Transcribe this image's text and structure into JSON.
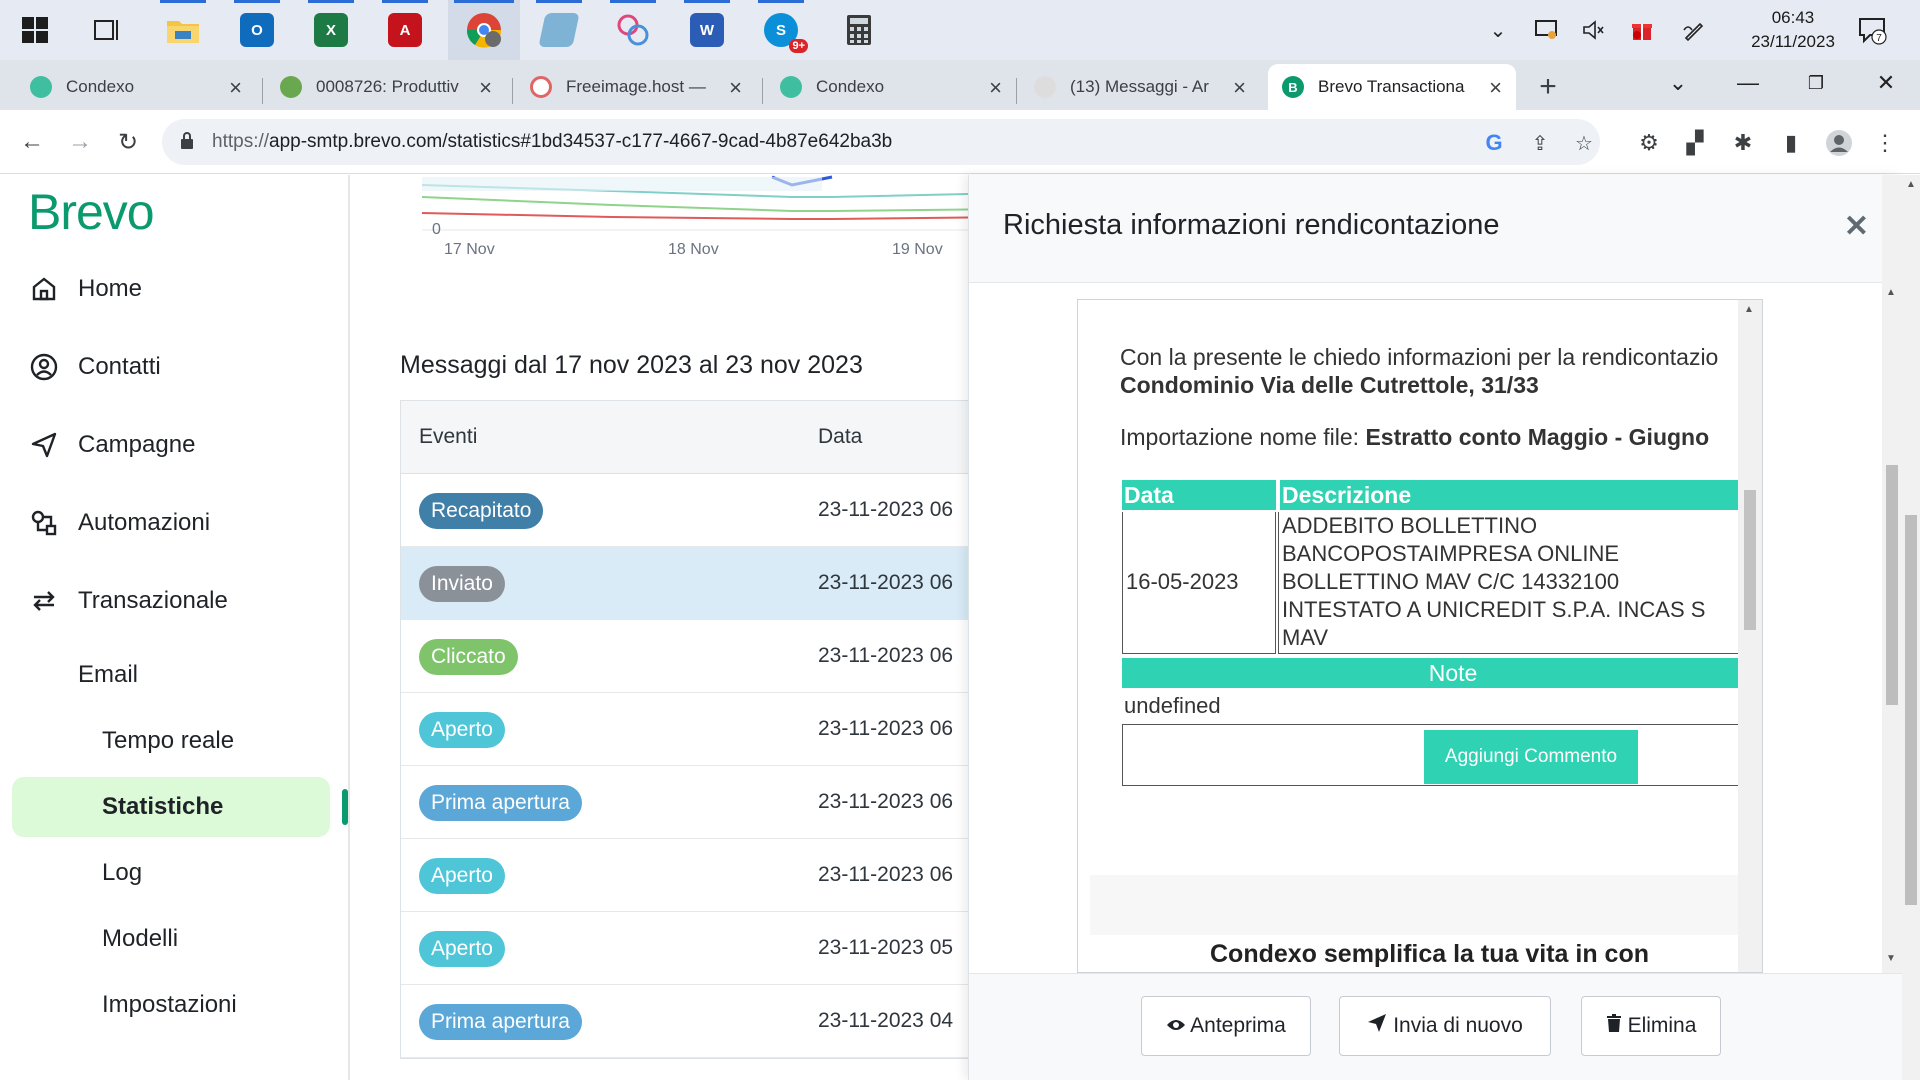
{
  "taskbar": {
    "clock_time": "06:43",
    "clock_date": "23/11/2023",
    "notifications_count": "7",
    "skype_badge": "9+"
  },
  "browser": {
    "tabs": [
      {
        "title": "Condexo",
        "favicon_color": "#3fbf9f"
      },
      {
        "title": "0008726: Produttiv",
        "favicon_color": "#6aa84f"
      },
      {
        "title": "Freeimage.host —",
        "favicon_color": "#e06666"
      },
      {
        "title": "Condexo",
        "favicon_color": "#3fbf9f"
      },
      {
        "title": "(13) Messaggi - Ar",
        "favicon_color": "#cccccc"
      },
      {
        "title": "Brevo Transactiona",
        "favicon_color": "#0b996e",
        "favicon_letter": "B"
      }
    ],
    "url_prefix": "https://",
    "url_rest": "app-smtp.brevo.com/statistics#1bd34537-c177-4667-9cad-4b87e642ba3b"
  },
  "sidebar": {
    "logo": "Brevo",
    "items": [
      {
        "label": "Home",
        "icon": "home-icon"
      },
      {
        "label": "Contatti",
        "icon": "contacts-icon"
      },
      {
        "label": "Campagne",
        "icon": "send-icon"
      },
      {
        "label": "Automazioni",
        "icon": "automation-icon"
      },
      {
        "label": "Transazionale",
        "icon": "transactional-icon"
      }
    ],
    "email_label": "Email",
    "sub_items": [
      "Tempo reale",
      "Statistiche",
      "Log",
      "Modelli",
      "Impostazioni"
    ],
    "active_sub_item": "Statistiche"
  },
  "main": {
    "chart_zero_label": "0",
    "chart_ticks": [
      "17 Nov",
      "18 Nov",
      "19 Nov"
    ],
    "messages_title": "Messaggi dal 17 nov 2023 al 23 nov 2023",
    "table_headers": {
      "events": "Eventi",
      "date": "Data"
    },
    "rows": [
      {
        "event": "Recapitato",
        "date": "23-11-2023 06",
        "color": "#3f7fa8"
      },
      {
        "event": "Inviato",
        "date": "23-11-2023 06",
        "color": "#8b9198"
      },
      {
        "event": "Cliccato",
        "date": "23-11-2023 06",
        "color": "#7fc46a"
      },
      {
        "event": "Aperto",
        "date": "23-11-2023 06",
        "color": "#4ec6d8"
      },
      {
        "event": "Prima apertura",
        "date": "23-11-2023 06",
        "color": "#5aa7d8"
      },
      {
        "event": "Aperto",
        "date": "23-11-2023 06",
        "color": "#4ec6d8"
      },
      {
        "event": "Aperto",
        "date": "23-11-2023 05",
        "color": "#4ec6d8"
      },
      {
        "event": "Prima apertura",
        "date": "23-11-2023 04",
        "color": "#5aa7d8"
      }
    ]
  },
  "drawer": {
    "title": "Richiesta informazioni rendicontazione",
    "email": {
      "intro": "Con la presente le chiedo informazioni per la rendicontazio",
      "condominium": "Condominio Via delle Cutrettole, 31/33",
      "import_label": "Importazione nome file: ",
      "import_file": "Estratto conto Maggio - Giugno",
      "col_date": "Data",
      "col_desc": "Descrizione",
      "row_date": "16-05-2023",
      "row_desc_lines": [
        "ADDEBITO BOLLETTINO",
        "BANCOPOSTAIMPRESA ONLINE",
        "BOLLETTINO MAV C/C 14332100",
        "INTESTATO A UNICREDIT S.P.A. INCAS S",
        "MAV"
      ],
      "notes_header": "Note",
      "notes_value": "undefined",
      "add_comment": "Aggiungi Commento",
      "footer_heading": "Condexo semplifica la tua vita in con"
    },
    "buttons": {
      "preview": "Anteprima",
      "resend": "Invia di nuovo",
      "delete": "Elimina"
    }
  }
}
